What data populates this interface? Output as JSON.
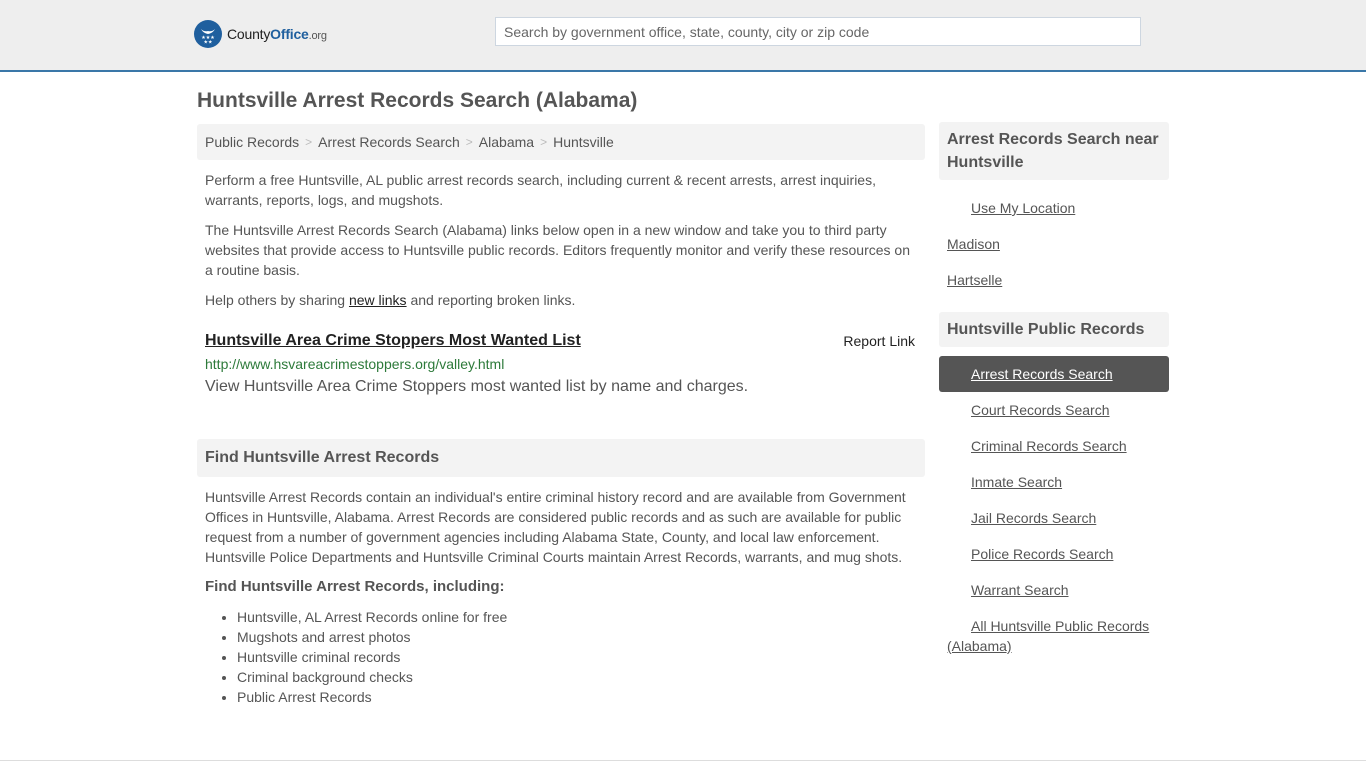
{
  "header": {
    "logo": {
      "name_part1": "County",
      "name_part2": "Office",
      "name_suffix": ".org",
      "brand_color": "#1f5f9e"
    },
    "search": {
      "placeholder": "Search by government office, state, county, city or zip code",
      "value": ""
    }
  },
  "page_title": "Huntsville Arrest Records Search (Alabama)",
  "breadcrumb": [
    {
      "label": "Public Records"
    },
    {
      "label": "Arrest Records Search"
    },
    {
      "label": "Alabama"
    },
    {
      "label": "Huntsville"
    }
  ],
  "breadcrumb_separator": ">",
  "intro": {
    "p1": "Perform a free Huntsville, AL public arrest records search, including current & recent arrests, arrest inquiries, warrants, reports, logs, and mugshots.",
    "p2": "The Huntsville Arrest Records Search (Alabama) links below open in a new window and take you to third party websites that provide access to Huntsville public records. Editors frequently monitor and verify these resources on a routine basis.",
    "p3_before": "Help others by sharing ",
    "p3_link": "new links",
    "p3_after": " and reporting broken links."
  },
  "resources": [
    {
      "title": "Huntsville Area Crime Stoppers Most Wanted List",
      "report_label": "Report Link",
      "url": "http://www.hsvareacrimestoppers.org/valley.html",
      "url_color": "#2d7a3a",
      "description": "View Huntsville Area Crime Stoppers most wanted list by name and charges."
    }
  ],
  "find_section": {
    "title": "Find Huntsville Arrest Records",
    "body": "Huntsville Arrest Records contain an individual's entire criminal history record and are available from Government Offices in Huntsville, Alabama. Arrest Records are considered public records and as such are available for public request from a number of government agencies including Alabama State, County, and local law enforcement. Huntsville Police Departments and Huntsville Criminal Courts maintain Arrest Records, warrants, and mug shots.",
    "subheading": "Find Huntsville Arrest Records, including:",
    "bullets": [
      "Huntsville, AL Arrest Records online for free",
      "Mugshots and arrest photos",
      "Huntsville criminal records",
      "Criminal background checks",
      "Public Arrest Records"
    ]
  },
  "sidebar": {
    "nearby": {
      "title": "Arrest Records Search near Huntsville",
      "use_location": "Use My Location",
      "places": [
        "Madison",
        "Hartselle"
      ]
    },
    "public_records": {
      "title": "Huntsville Public Records",
      "active_color": "#555555",
      "items": [
        {
          "label": "Arrest Records Search",
          "active": true
        },
        {
          "label": "Court Records Search",
          "active": false
        },
        {
          "label": "Criminal Records Search",
          "active": false
        },
        {
          "label": "Inmate Search",
          "active": false
        },
        {
          "label": "Jail Records Search",
          "active": false
        },
        {
          "label": "Police Records Search",
          "active": false
        },
        {
          "label": "Warrant Search",
          "active": false
        },
        {
          "label": "All Huntsville Public Records (Alabama)",
          "active": false
        }
      ]
    }
  }
}
